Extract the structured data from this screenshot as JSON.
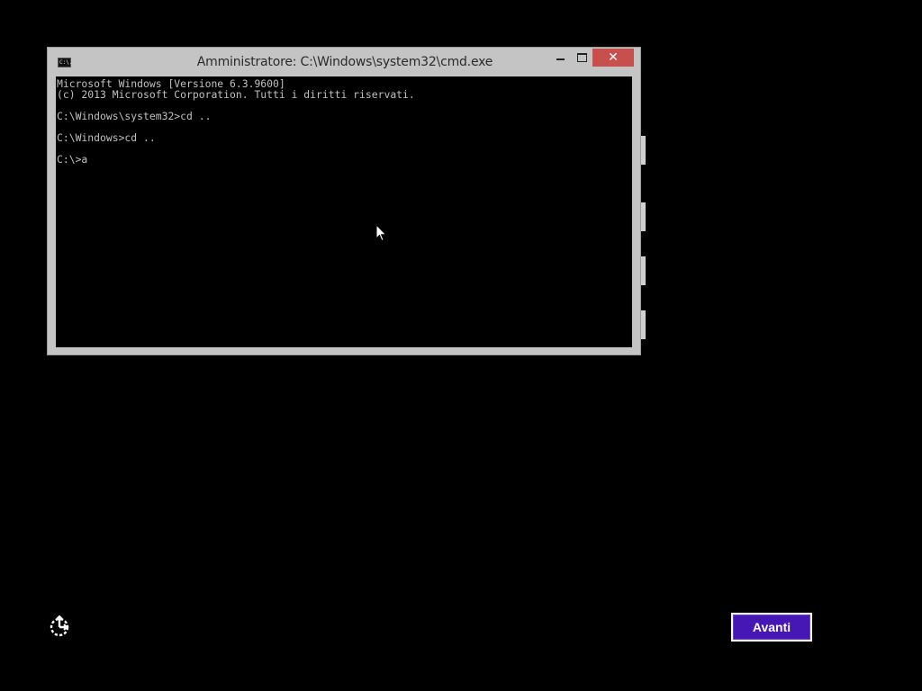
{
  "window": {
    "title": "Amministratore: C:\\Windows\\system32\\cmd.exe",
    "icon_text": "C:\\.",
    "controls": {
      "minimize": "minimize-icon",
      "maximize": "maximize-icon",
      "close": "✕"
    }
  },
  "console": {
    "lines": [
      "Microsoft Windows [Versione 6.3.9600]",
      "(c) 2013 Microsoft Corporation. Tutti i diritti riservati.",
      "",
      "C:\\Windows\\system32>cd ..",
      "",
      "C:\\Windows>cd ..",
      "",
      "C:\\>a"
    ]
  },
  "footer": {
    "ease_of_access_icon": "ease-of-access-icon",
    "next_label": "Avanti"
  },
  "colors": {
    "background": "#000000",
    "window_frame": "#c4c4c4",
    "close_button": "#c7504c",
    "console_text": "#c0c0c0",
    "next_button": "#4617b4"
  }
}
